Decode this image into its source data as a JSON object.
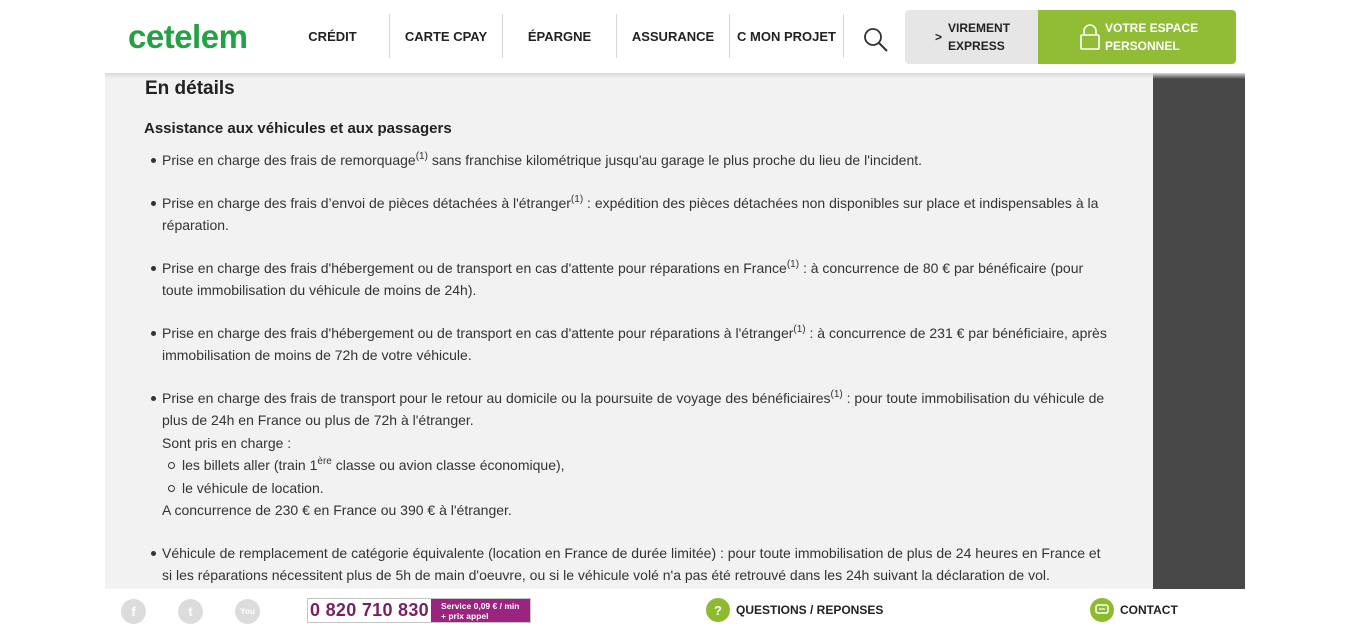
{
  "header": {
    "logo": "cetelem",
    "nav": [
      "CRÉDIT",
      "CARTE CPAY",
      "ÉPARGNE",
      "ASSURANCE",
      "C MON PROJET"
    ],
    "virement": {
      "chevron": ">",
      "label_line1": "VIREMENT",
      "label_line2": "EXPRESS"
    },
    "espace": {
      "label_line1": "VOTRE ESPACE",
      "label_line2": "PERSONNEL"
    }
  },
  "content": {
    "title": "En détails",
    "subtitle": "Assistance aux véhicules et aux passagers",
    "items": [
      {
        "before": "Prise en charge des frais de remorquage",
        "sup": "(1)",
        "after": " sans franchise kilométrique jusqu'au garage le plus proche du lieu de l'incident."
      },
      {
        "before": "Prise en charge des frais d’envoi de pièces détachées à l'étranger",
        "sup": "(1)",
        "after": " : expédition des pièces détachées non disponibles sur place et indispensables à la réparation."
      },
      {
        "before": "Prise en charge des frais d'hébergement ou de transport en cas d'attente pour réparations en France",
        "sup": "(1)",
        "after": " : à concurrence de 80 € par bénéficaire (pour toute immobilisation du véhicule de moins de 24h)."
      },
      {
        "before": "Prise en charge des frais d'hébergement ou de transport en cas d'attente pour réparations à l'étranger",
        "sup": "(1)",
        "after": " : à concurrence de 231 € par bénéficiaire, après immobilisation de moins de 72h de votre véhicule."
      },
      {
        "before": "Prise en charge des frais de transport pour le retour au domicile ou la poursuite de voyage des bénéficiaires",
        "sup": "(1)",
        "after": " : pour toute immobilisation du véhicule de plus de 24h en France ou plus de 72h à l'étranger."
      }
    ],
    "pris_en_charge": "Sont pris en charge :",
    "sub_items": [
      {
        "before": "les billets aller (train 1",
        "sup": "ère",
        "after": " classe ou avion classe économique),"
      },
      {
        "before": "le véhicule de location.",
        "sup": "",
        "after": ""
      }
    ],
    "concurrence": "A concurrence de 230 € en France ou 390 € à l'étranger.",
    "last_item": "Véhicule de remplacement de catégorie équivalente (location en France de durée limitée) : pour toute immobilisation de plus de 24 heures en France et si les réparations nécessitent plus de 5h de main d'oeuvre, ou si le véhicule volé n'a pas été retrouvé dans les 24h suivant la déclaration de vol."
  },
  "footer": {
    "social": [
      "f",
      "t",
      "You"
    ],
    "phone": "0 820 710 830",
    "tarif_line1": "Service 0,09 € / min",
    "tarif_line2": "+ prix appel",
    "questions": "QUESTIONS / REPONSES",
    "contact": "CONTACT"
  },
  "colors": {
    "brand_green": "#25a044",
    "espace_green": "#90bd35",
    "phone_purple": "#9b2480",
    "sidebar": "#484848"
  }
}
